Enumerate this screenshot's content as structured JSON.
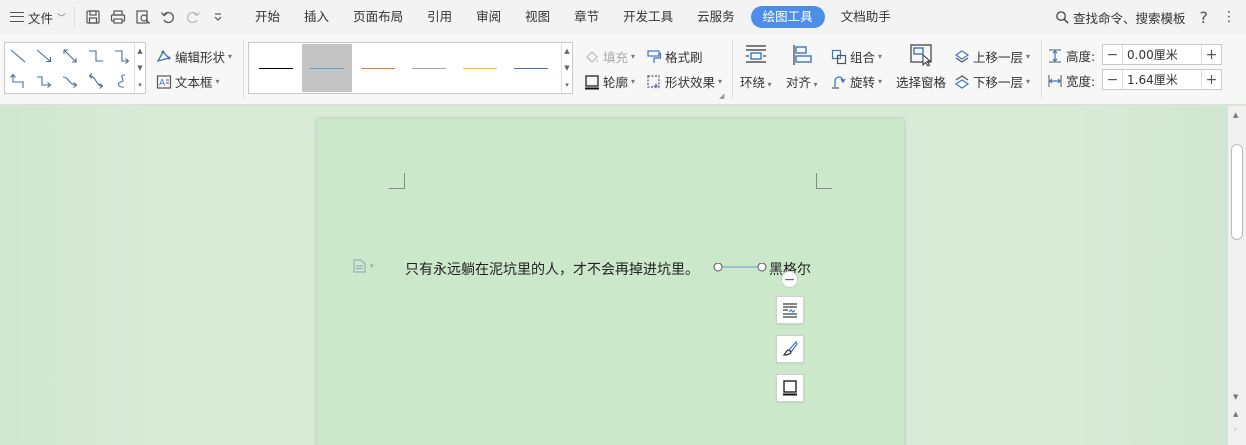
{
  "menubar": {
    "file_label": "文件",
    "tabs": [
      {
        "label": "开始"
      },
      {
        "label": "插入"
      },
      {
        "label": "页面布局"
      },
      {
        "label": "引用"
      },
      {
        "label": "审阅"
      },
      {
        "label": "视图"
      },
      {
        "label": "章节"
      },
      {
        "label": "开发工具"
      },
      {
        "label": "云服务"
      },
      {
        "label": "绘图工具",
        "active": true
      },
      {
        "label": "文档助手"
      }
    ],
    "search_label": "查找命令、搜索模板",
    "help_label": "?",
    "more_label": "⋮"
  },
  "ribbon": {
    "edit_shape": "编辑形状",
    "text_box": "文本框",
    "fill": "填充",
    "outline": "轮廓",
    "format_painter": "格式刷",
    "shape_effects": "形状效果",
    "wrap": "环绕",
    "align": "对齐",
    "group": "组合",
    "rotate": "旋转",
    "selection_pane": "选择窗格",
    "bring_forward": "上移一层",
    "send_backward": "下移一层",
    "height_label": "高度:",
    "height_value": "0.00厘米",
    "width_label": "宽度:",
    "width_value": "1.64厘米",
    "line_styles": [
      {
        "color": "#000000"
      },
      {
        "color": "#5b9bd5",
        "selected": true
      },
      {
        "color": "#ed7d31"
      },
      {
        "color": "#a5a5a5"
      },
      {
        "color": "#ffc000"
      },
      {
        "color": "#4472c4"
      }
    ]
  },
  "document": {
    "text": "只有永远躺在泥坑里的人，才不会再掉进坑里。",
    "author": "黑格尔"
  },
  "colors": {
    "accent": "#4d8fe8",
    "page": "#cce8cb",
    "workspace": "#d9ead7"
  }
}
